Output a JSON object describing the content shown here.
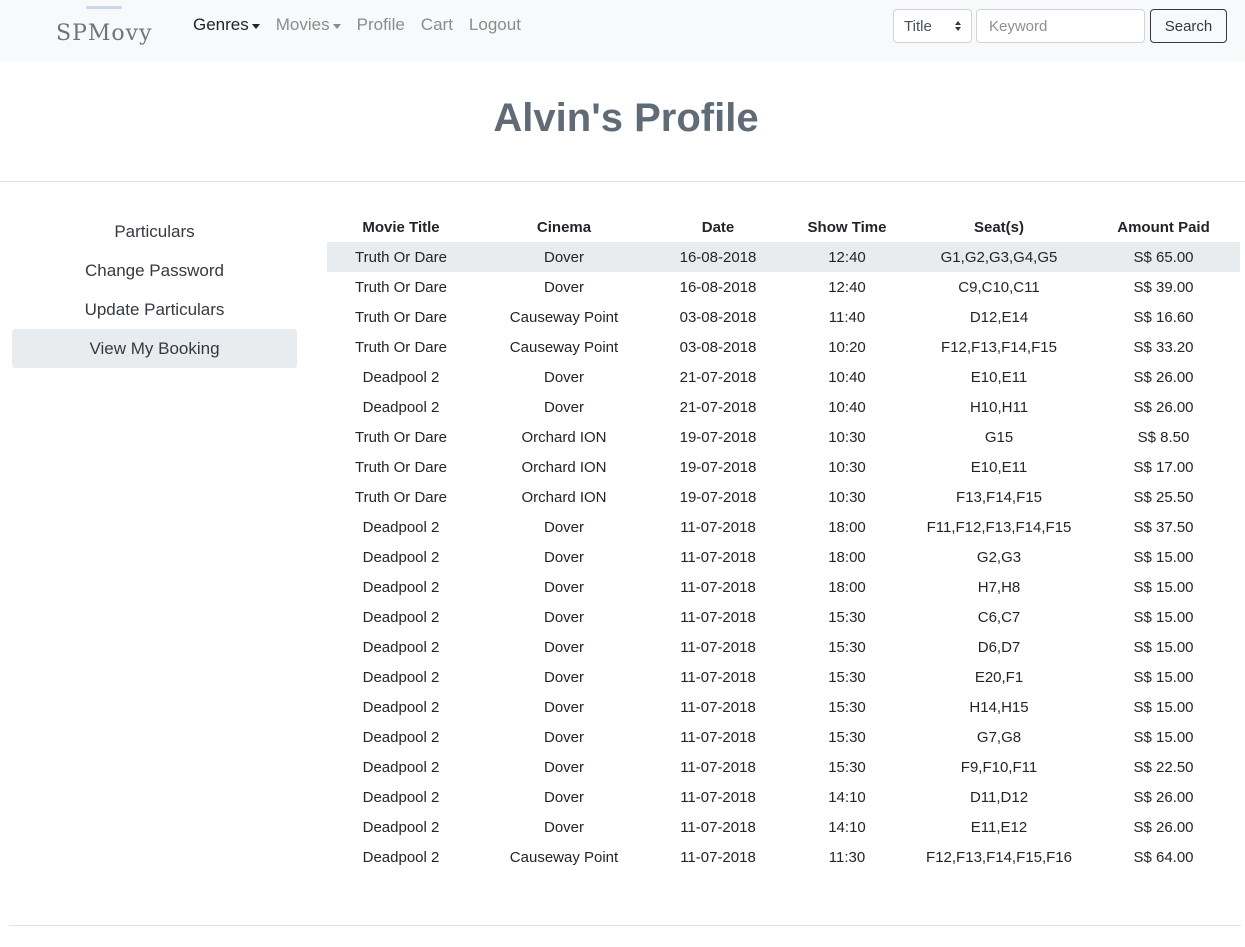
{
  "navbar": {
    "brand": "SPMovy",
    "links": [
      {
        "label": "Genres",
        "dropdown": true,
        "active": true
      },
      {
        "label": "Movies",
        "dropdown": true,
        "active": false
      },
      {
        "label": "Profile",
        "dropdown": false,
        "active": false
      },
      {
        "label": "Cart",
        "dropdown": false,
        "active": false
      },
      {
        "label": "Logout",
        "dropdown": false,
        "active": false
      }
    ],
    "search": {
      "field_selected": "Title",
      "keyword_placeholder": "Keyword",
      "keyword_value": "",
      "button_label": "Search"
    }
  },
  "page_title": "Alvin's Profile",
  "sidebar": {
    "items": [
      {
        "label": "Particulars",
        "active": false
      },
      {
        "label": "Change Password",
        "active": false
      },
      {
        "label": "Update Particulars",
        "active": false
      },
      {
        "label": "View My Booking",
        "active": true
      }
    ]
  },
  "bookings": {
    "headers": [
      "Movie Title",
      "Cinema",
      "Date",
      "Show Time",
      "Seat(s)",
      "Amount Paid"
    ],
    "rows": [
      [
        "Truth Or Dare",
        "Dover",
        "16-08-2018",
        "12:40",
        "G1,G2,G3,G4,G5",
        "S$ 65.00"
      ],
      [
        "Truth Or Dare",
        "Dover",
        "16-08-2018",
        "12:40",
        "C9,C10,C11",
        "S$ 39.00"
      ],
      [
        "Truth Or Dare",
        "Causeway Point",
        "03-08-2018",
        "11:40",
        "D12,E14",
        "S$ 16.60"
      ],
      [
        "Truth Or Dare",
        "Causeway Point",
        "03-08-2018",
        "10:20",
        "F12,F13,F14,F15",
        "S$ 33.20"
      ],
      [
        "Deadpool 2",
        "Dover",
        "21-07-2018",
        "10:40",
        "E10,E11",
        "S$ 26.00"
      ],
      [
        "Deadpool 2",
        "Dover",
        "21-07-2018",
        "10:40",
        "H10,H11",
        "S$ 26.00"
      ],
      [
        "Truth Or Dare",
        "Orchard ION",
        "19-07-2018",
        "10:30",
        "G15",
        "S$ 8.50"
      ],
      [
        "Truth Or Dare",
        "Orchard ION",
        "19-07-2018",
        "10:30",
        "E10,E11",
        "S$ 17.00"
      ],
      [
        "Truth Or Dare",
        "Orchard ION",
        "19-07-2018",
        "10:30",
        "F13,F14,F15",
        "S$ 25.50"
      ],
      [
        "Deadpool 2",
        "Dover",
        "11-07-2018",
        "18:00",
        "F11,F12,F13,F14,F15",
        "S$ 37.50"
      ],
      [
        "Deadpool 2",
        "Dover",
        "11-07-2018",
        "18:00",
        "G2,G3",
        "S$ 15.00"
      ],
      [
        "Deadpool 2",
        "Dover",
        "11-07-2018",
        "18:00",
        "H7,H8",
        "S$ 15.00"
      ],
      [
        "Deadpool 2",
        "Dover",
        "11-07-2018",
        "15:30",
        "C6,C7",
        "S$ 15.00"
      ],
      [
        "Deadpool 2",
        "Dover",
        "11-07-2018",
        "15:30",
        "D6,D7",
        "S$ 15.00"
      ],
      [
        "Deadpool 2",
        "Dover",
        "11-07-2018",
        "15:30",
        "E20,F1",
        "S$ 15.00"
      ],
      [
        "Deadpool 2",
        "Dover",
        "11-07-2018",
        "15:30",
        "H14,H15",
        "S$ 15.00"
      ],
      [
        "Deadpool 2",
        "Dover",
        "11-07-2018",
        "15:30",
        "G7,G8",
        "S$ 15.00"
      ],
      [
        "Deadpool 2",
        "Dover",
        "11-07-2018",
        "15:30",
        "F9,F10,F11",
        "S$ 22.50"
      ],
      [
        "Deadpool 2",
        "Dover",
        "11-07-2018",
        "14:10",
        "D11,D12",
        "S$ 26.00"
      ],
      [
        "Deadpool 2",
        "Dover",
        "11-07-2018",
        "14:10",
        "E11,E12",
        "S$ 26.00"
      ],
      [
        "Deadpool 2",
        "Causeway Point",
        "11-07-2018",
        "11:30",
        "F12,F13,F14,F15,F16",
        "S$ 64.00"
      ]
    ]
  },
  "colors": {
    "navbar_bg": "#f8f9fa",
    "title": "#5f6b76",
    "active_bg": "#e9ecef"
  }
}
